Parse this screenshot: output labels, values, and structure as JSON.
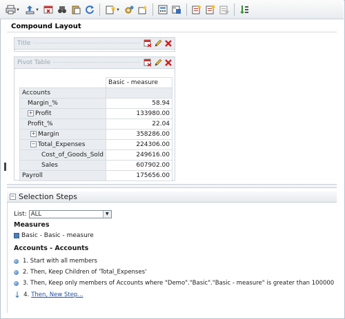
{
  "toolbar": {
    "icons": [
      "print-menu",
      "export-menu",
      "delete-view",
      "preview",
      "paste",
      "refresh",
      "new-view-menu",
      "query-dropdown",
      "properties",
      "filters",
      "prompts",
      "save",
      "edit-analysis",
      "settings",
      "sort"
    ]
  },
  "compound_layout": {
    "title": "Compound Layout"
  },
  "title_view": {
    "label": "Title"
  },
  "pivot_view": {
    "label": "Pivot Table",
    "column_header": "Basic - measure",
    "rows": [
      {
        "label": "Accounts",
        "value": "",
        "indent": 0,
        "toggle": ""
      },
      {
        "label": "Margin_%",
        "value": "58.94",
        "indent": 1,
        "toggle": ""
      },
      {
        "label": "Profit",
        "value": "133980.00",
        "indent": 1,
        "toggle": "+"
      },
      {
        "label": "Profit_%",
        "value": "22.04",
        "indent": 1,
        "toggle": ""
      },
      {
        "label": "Margin",
        "value": "358286.00",
        "indent": 2,
        "toggle": "+"
      },
      {
        "label": "Total_Expenses",
        "value": "224306.00",
        "indent": 2,
        "toggle": "−"
      },
      {
        "label": "Cost_of_Goods_Sold",
        "value": "249616.00",
        "indent": 3,
        "toggle": ""
      },
      {
        "label": "Sales",
        "value": "607902.00",
        "indent": 3,
        "toggle": ""
      },
      {
        "label": "Payroll",
        "value": "175656.00",
        "indent": 0,
        "toggle": ""
      }
    ]
  },
  "selection_steps": {
    "title": "Selection Steps",
    "toggle": "−",
    "list_label": "List:",
    "list_value": "ALL",
    "measures_title": "Measures",
    "measure_item": "Basic - Basic - measure",
    "accounts_title": "Accounts - Accounts",
    "steps": [
      "1. Start with all members",
      "2. Then, Keep Children of 'Total_Expenses'",
      "3. Then, Keep only members of Accounts where \"Demo\".\"Basic\".\"Basic - measure\" is greater than 100000"
    ],
    "new_step_number": "4.",
    "new_step_link": "Then, New Step..."
  }
}
